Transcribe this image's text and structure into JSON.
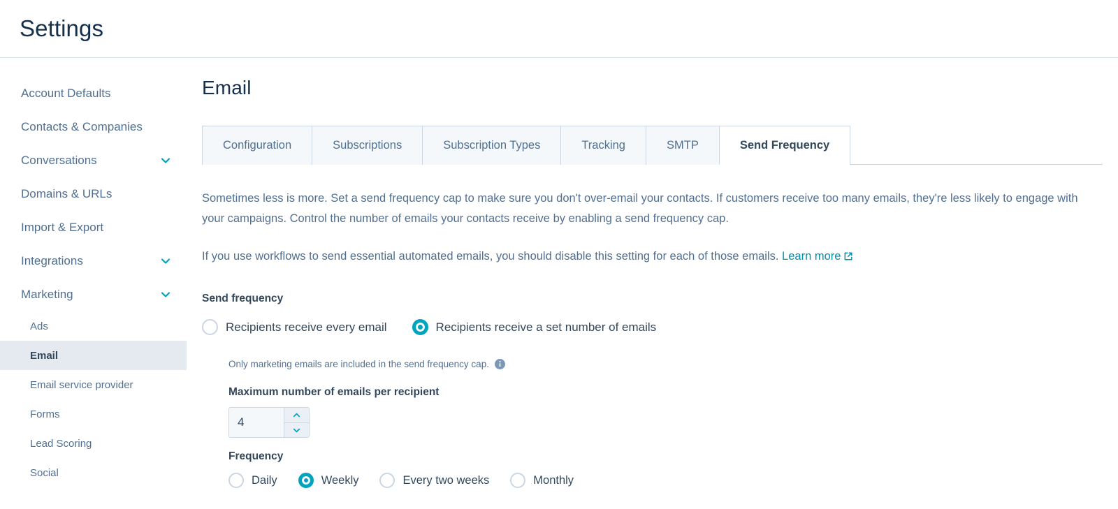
{
  "header": {
    "title": "Settings"
  },
  "sidebar": {
    "items": [
      {
        "label": "Account Defaults",
        "expandable": false
      },
      {
        "label": "Contacts & Companies",
        "expandable": false
      },
      {
        "label": "Conversations",
        "expandable": true
      },
      {
        "label": "Domains & URLs",
        "expandable": false
      },
      {
        "label": "Import & Export",
        "expandable": false
      },
      {
        "label": "Integrations",
        "expandable": true
      },
      {
        "label": "Marketing",
        "expandable": true
      }
    ],
    "sub_items": [
      {
        "label": "Ads",
        "active": false
      },
      {
        "label": "Email",
        "active": true
      },
      {
        "label": "Email service provider",
        "active": false
      },
      {
        "label": "Forms",
        "active": false
      },
      {
        "label": "Lead Scoring",
        "active": false
      },
      {
        "label": "Social",
        "active": false
      }
    ]
  },
  "main": {
    "page_title": "Email",
    "tabs": [
      {
        "label": "Configuration",
        "active": false
      },
      {
        "label": "Subscriptions",
        "active": false
      },
      {
        "label": "Subscription Types",
        "active": false
      },
      {
        "label": "Tracking",
        "active": false
      },
      {
        "label": "SMTP",
        "active": false
      },
      {
        "label": "Send Frequency",
        "active": true
      }
    ],
    "paragraph_1": "Sometimes less is more. Set a send frequency cap to make sure you don't over-email your contacts. If customers receive too many emails, they're less likely to engage with your campaigns. Control the number of emails your contacts receive by enabling a send frequency cap.",
    "paragraph_2_text": "If you use workflows to send essential automated emails, you should disable this setting for each of those emails.",
    "learn_more_label": "Learn more",
    "send_frequency": {
      "label": "Send frequency",
      "options": [
        {
          "label": "Recipients receive every email",
          "checked": false
        },
        {
          "label": "Recipients receive a set number of emails",
          "checked": true
        }
      ]
    },
    "cap_panel": {
      "note": "Only marketing emails are included in the send frequency cap.",
      "max_label": "Maximum number of emails per recipient",
      "max_value": "4",
      "max_placeholder": "",
      "frequency_label": "Frequency",
      "frequency_options": [
        {
          "label": "Daily",
          "checked": false
        },
        {
          "label": "Weekly",
          "checked": true
        },
        {
          "label": "Every two weeks",
          "checked": false
        },
        {
          "label": "Monthly",
          "checked": false
        }
      ]
    }
  },
  "colors": {
    "accent_teal": "#00a4bd",
    "link": "#0091ae",
    "text_dark": "#33475b",
    "text_muted": "#516f90",
    "title": "#15304b",
    "border": "#cbd6e2",
    "tab_inactive_bg": "#f5f8fa",
    "sidebar_active_bg": "#e5eaf0"
  }
}
